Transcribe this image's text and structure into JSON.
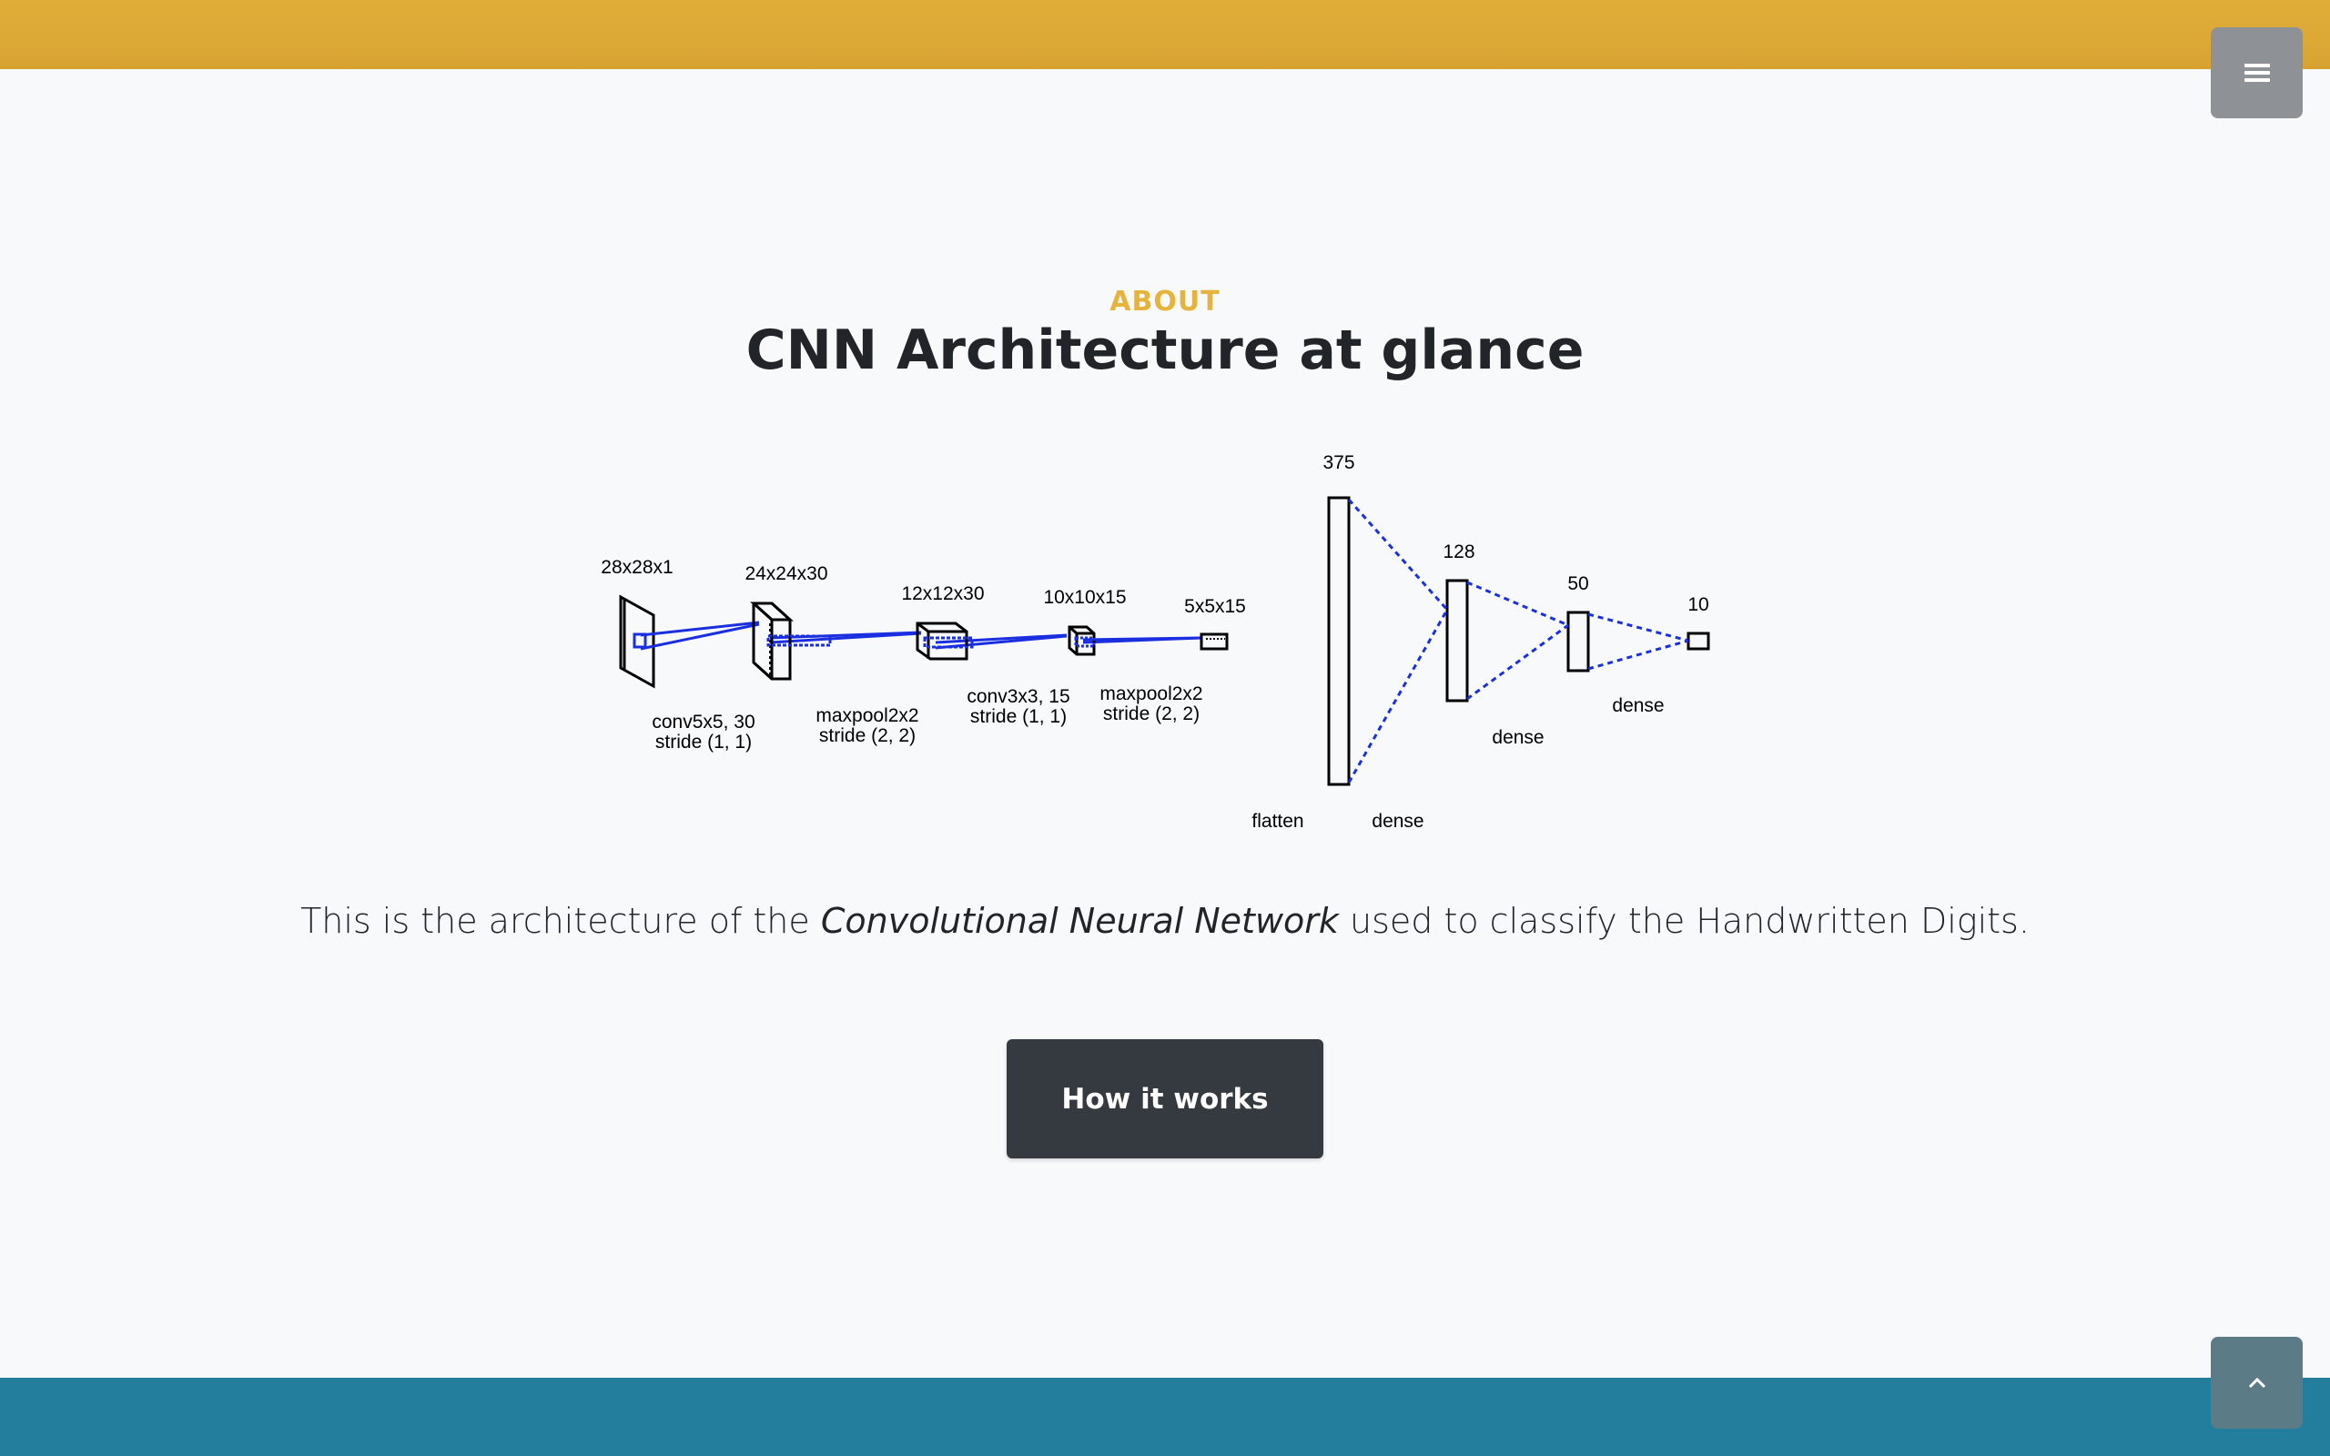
{
  "nav": {
    "menu_icon": "hamburger-icon",
    "colors": {
      "header": "#dca836"
    }
  },
  "about": {
    "label": "ABOUT",
    "title": "CNN Architecture at glance",
    "label_color": "#e6b43c"
  },
  "diagram": {
    "layers": [
      {
        "size": "28x28x1"
      },
      {
        "size": "24x24x30"
      },
      {
        "size": "12x12x30"
      },
      {
        "size": "10x10x15"
      },
      {
        "size": "5x5x15"
      },
      {
        "size": "375"
      },
      {
        "size": "128"
      },
      {
        "size": "50"
      },
      {
        "size": "10"
      }
    ],
    "ops": [
      {
        "line1": "conv5x5, 30",
        "line2": "stride (1, 1)"
      },
      {
        "line1": "maxpool2x2",
        "line2": "stride (2, 2)"
      },
      {
        "line1": "conv3x3, 15",
        "line2": "stride (1, 1)"
      },
      {
        "line1": "maxpool2x2",
        "line2": "stride (2, 2)"
      },
      {
        "line1": "flatten"
      },
      {
        "line1": "dense"
      },
      {
        "line1": "dense"
      },
      {
        "line1": "dense"
      }
    ],
    "connection_color": "#1a2fe0"
  },
  "description": {
    "before": "This is the architecture of the ",
    "emphasis": "Convolutional Neural Network",
    "after": " used to classify the Handwritten Digits."
  },
  "cta": {
    "label": "How it works"
  },
  "footer": {
    "scroll_top_icon": "chevron-up-icon",
    "color": "#237e9d"
  }
}
